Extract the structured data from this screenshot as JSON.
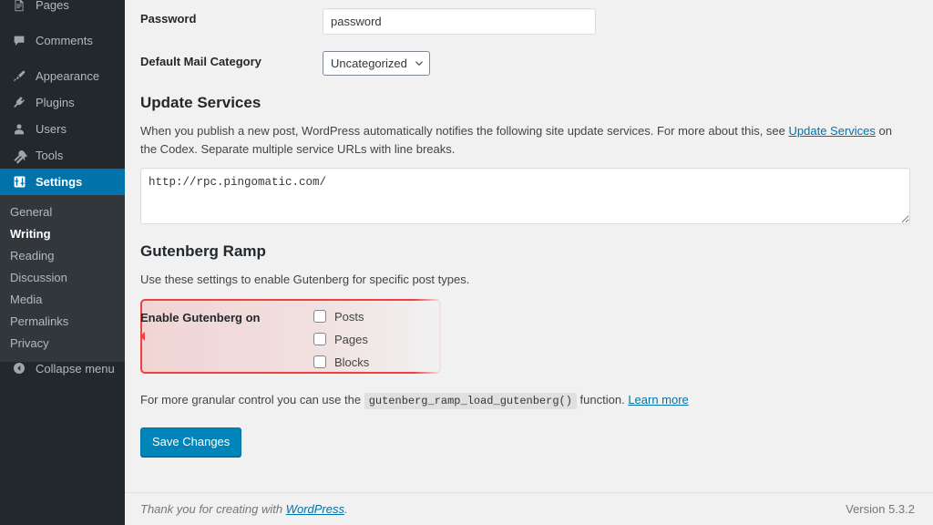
{
  "sidebar": {
    "menu": [
      {
        "label": "Pages",
        "icon": "pages-icon",
        "current": false
      },
      {
        "label": "Comments",
        "icon": "comments-icon",
        "current": false
      },
      {
        "label": "Appearance",
        "icon": "appearance-brush-icon",
        "current": false
      },
      {
        "label": "Plugins",
        "icon": "plugins-plug-icon",
        "current": false
      },
      {
        "label": "Users",
        "icon": "users-icon",
        "current": false
      },
      {
        "label": "Tools",
        "icon": "tools-wrench-icon",
        "current": false
      },
      {
        "label": "Settings",
        "icon": "settings-sliders-icon",
        "current": true
      }
    ],
    "submenu": [
      {
        "label": "General",
        "current": false
      },
      {
        "label": "Writing",
        "current": true
      },
      {
        "label": "Reading",
        "current": false
      },
      {
        "label": "Discussion",
        "current": false
      },
      {
        "label": "Media",
        "current": false
      },
      {
        "label": "Permalinks",
        "current": false
      },
      {
        "label": "Privacy",
        "current": false
      }
    ],
    "collapse_label": "Collapse menu",
    "collapse_icon": "collapse-arrow-left-icon",
    "current_color": "#0073aa",
    "background": "#23282d",
    "submenu_background": "#32373c"
  },
  "form": {
    "password_label": "Password",
    "password_value": "password",
    "mail_category_label": "Default Mail Category",
    "mail_category_value": "Uncategorized",
    "mail_category_options": [
      "Uncategorized"
    ]
  },
  "update_services": {
    "title": "Update Services",
    "desc_part1": "When you publish a new post, WordPress automatically notifies the following site update services. For more about this, see ",
    "desc_link": "Update Services",
    "desc_part2": " on the Codex. Separate multiple service URLs with line breaks.",
    "textarea_value": "http://rpc.pingomatic.com/"
  },
  "gutenberg_ramp": {
    "title": "Gutenberg Ramp",
    "desc": "Use these settings to enable Gutenberg for specific post types.",
    "row_label": "Enable Gutenberg on",
    "checkboxes": [
      {
        "label": "Posts",
        "checked": false
      },
      {
        "label": "Pages",
        "checked": false
      },
      {
        "label": "Blocks",
        "checked": false
      }
    ],
    "granular_part1": "For more granular control you can use the ",
    "granular_code": "gutenberg_ramp_load_gutenberg()",
    "granular_part2": " function. ",
    "granular_link": "Learn more",
    "highlight_color": "#f04040"
  },
  "submit": {
    "save_label": "Save Changes",
    "button_color": "#0085ba"
  },
  "footer": {
    "thanks_prefix": "Thank you for creating with ",
    "thanks_link": "WordPress",
    "thanks_suffix": ".",
    "version": "Version 5.3.2"
  }
}
